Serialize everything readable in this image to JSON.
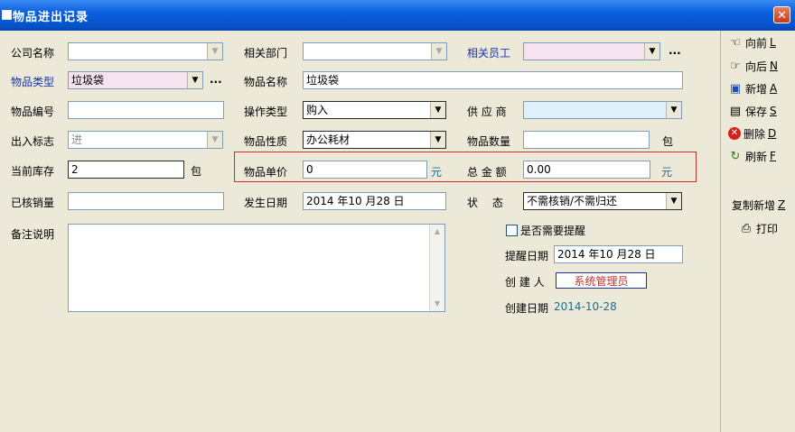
{
  "window": {
    "title": "物品进出记录",
    "close_glyph": "✕"
  },
  "form": {
    "company_label": "公司名称",
    "company_value": "",
    "dept_label": "相关部门",
    "dept_value": "",
    "staff_label": "相关员工",
    "staff_value": "",
    "item_type_label": "物品类型",
    "item_type_value": "垃圾袋",
    "item_name_label": "物品名称",
    "item_name_value": "垃圾袋",
    "item_code_label": "物品编号",
    "item_code_value": "",
    "op_type_label": "操作类型",
    "op_type_value": "购入",
    "supplier_label": "供 应 商",
    "supplier_value": "",
    "io_flag_label": "出入标志",
    "io_flag_value": "进",
    "item_nature_label": "物品性质",
    "item_nature_value": "办公耗材",
    "item_qty_label": "物品数量",
    "item_qty_value": "",
    "qty_unit": "包",
    "stock_label": "当前库存",
    "stock_value": "2",
    "stock_unit": "包",
    "unit_price_label": "物品单价",
    "unit_price_value": "0",
    "price_unit": "元",
    "total_label": "总 金 额",
    "total_value": "0.00",
    "total_unit": "元",
    "written_off_label": "已核销量",
    "written_off_value": "",
    "date_label": "发生日期",
    "date_value": "2014 年10 月28 日",
    "status_label": "状　 态",
    "status_value": "不需核销/不需归还",
    "notes_label": "备注说明",
    "notes_value": "",
    "remind_label": "是否需要提醒",
    "remind_date_label": "提醒日期",
    "remind_date_value": "2014 年10 月28 日",
    "creator_label": "创 建 人",
    "creator_value": "系统管理员",
    "created_date_label": "创建日期",
    "created_date_value": "2014-10-28",
    "ellipsis": "...",
    "dropdown_glyph": "▼",
    "scroll_up_glyph": "▲",
    "scroll_down_glyph": "▼"
  },
  "toolbar": {
    "prev": {
      "label": "向前",
      "key": "L",
      "icon": "☜"
    },
    "next": {
      "label": "向后",
      "key": "N",
      "icon": "☞"
    },
    "new": {
      "label": "新增",
      "key": "A",
      "icon": "▣"
    },
    "save": {
      "label": "保存",
      "key": "S",
      "icon": "▤"
    },
    "delete": {
      "label": "删除",
      "key": "D",
      "icon": "✕"
    },
    "refresh": {
      "label": "刷新",
      "key": "F",
      "icon": "↻"
    },
    "copy_new": {
      "label": "复制新增",
      "key": "Z"
    },
    "print": {
      "label": "打印",
      "icon": "⎙"
    }
  }
}
